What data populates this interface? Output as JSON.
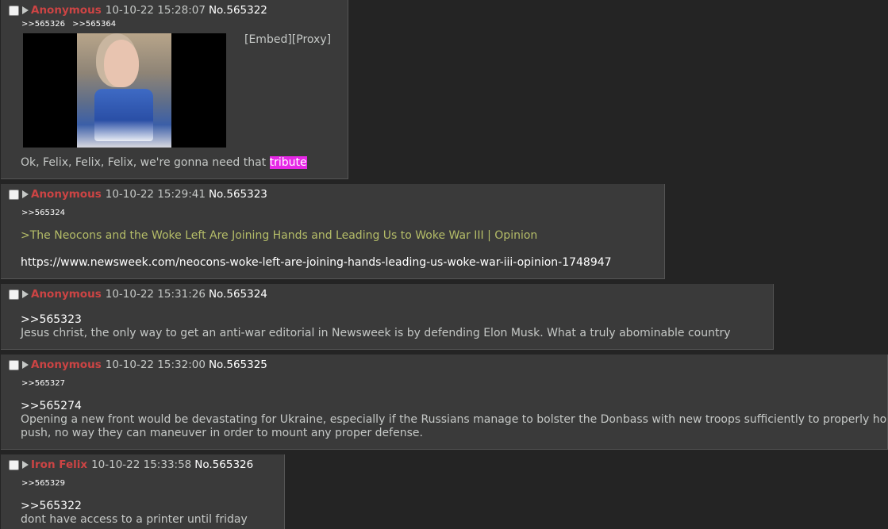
{
  "posts": [
    {
      "name": "Anonymous",
      "datetime": "10-10-22 15:28:07",
      "number": "No.565322",
      "backlinks": [
        ">>565326",
        ">>565364"
      ],
      "embed": "[Embed]",
      "proxy": "[Proxy]",
      "text_prefix": "Ok, Felix, Felix, Felix, we're gonna need that ",
      "text_highlight": "tribute"
    },
    {
      "name": "Anonymous",
      "datetime": "10-10-22 15:29:41",
      "number": "No.565323",
      "backlinks": [
        ">>565324"
      ],
      "greentext": ">The Neocons and the Woke Left Are Joining Hands and Leading Us to Woke War III | Opinion",
      "url": "https://www.newsweek.com/neocons-woke-left-are-joining-hands-leading-us-woke-war-iii-opinion-1748947"
    },
    {
      "name": "Anonymous",
      "datetime": "10-10-22 15:31:26",
      "number": "No.565324",
      "quote": ">>565323",
      "text": "Jesus christ, the only way to get an anti-war editorial in Newsweek is by defending Elon Musk. What a truly abominable country"
    },
    {
      "name": "Anonymous",
      "datetime": "10-10-22 15:32:00",
      "number": "No.565325",
      "backlinks": [
        ">>565327"
      ],
      "quote": ">>565274",
      "line1": "Opening a new front would be devastating for Ukraine, especially if the Russians manage to bolster the Donbass with new troops sufficiently to properly ho",
      "line2": "push, no way they can maneuver in order to mount any proper defense."
    },
    {
      "name": "Iron Felix",
      "datetime": "10-10-22 15:33:58",
      "number": "No.565326",
      "backlinks": [
        ">>565329"
      ],
      "quote": ">>565322",
      "text": "dont have access to a printer until friday"
    }
  ]
}
